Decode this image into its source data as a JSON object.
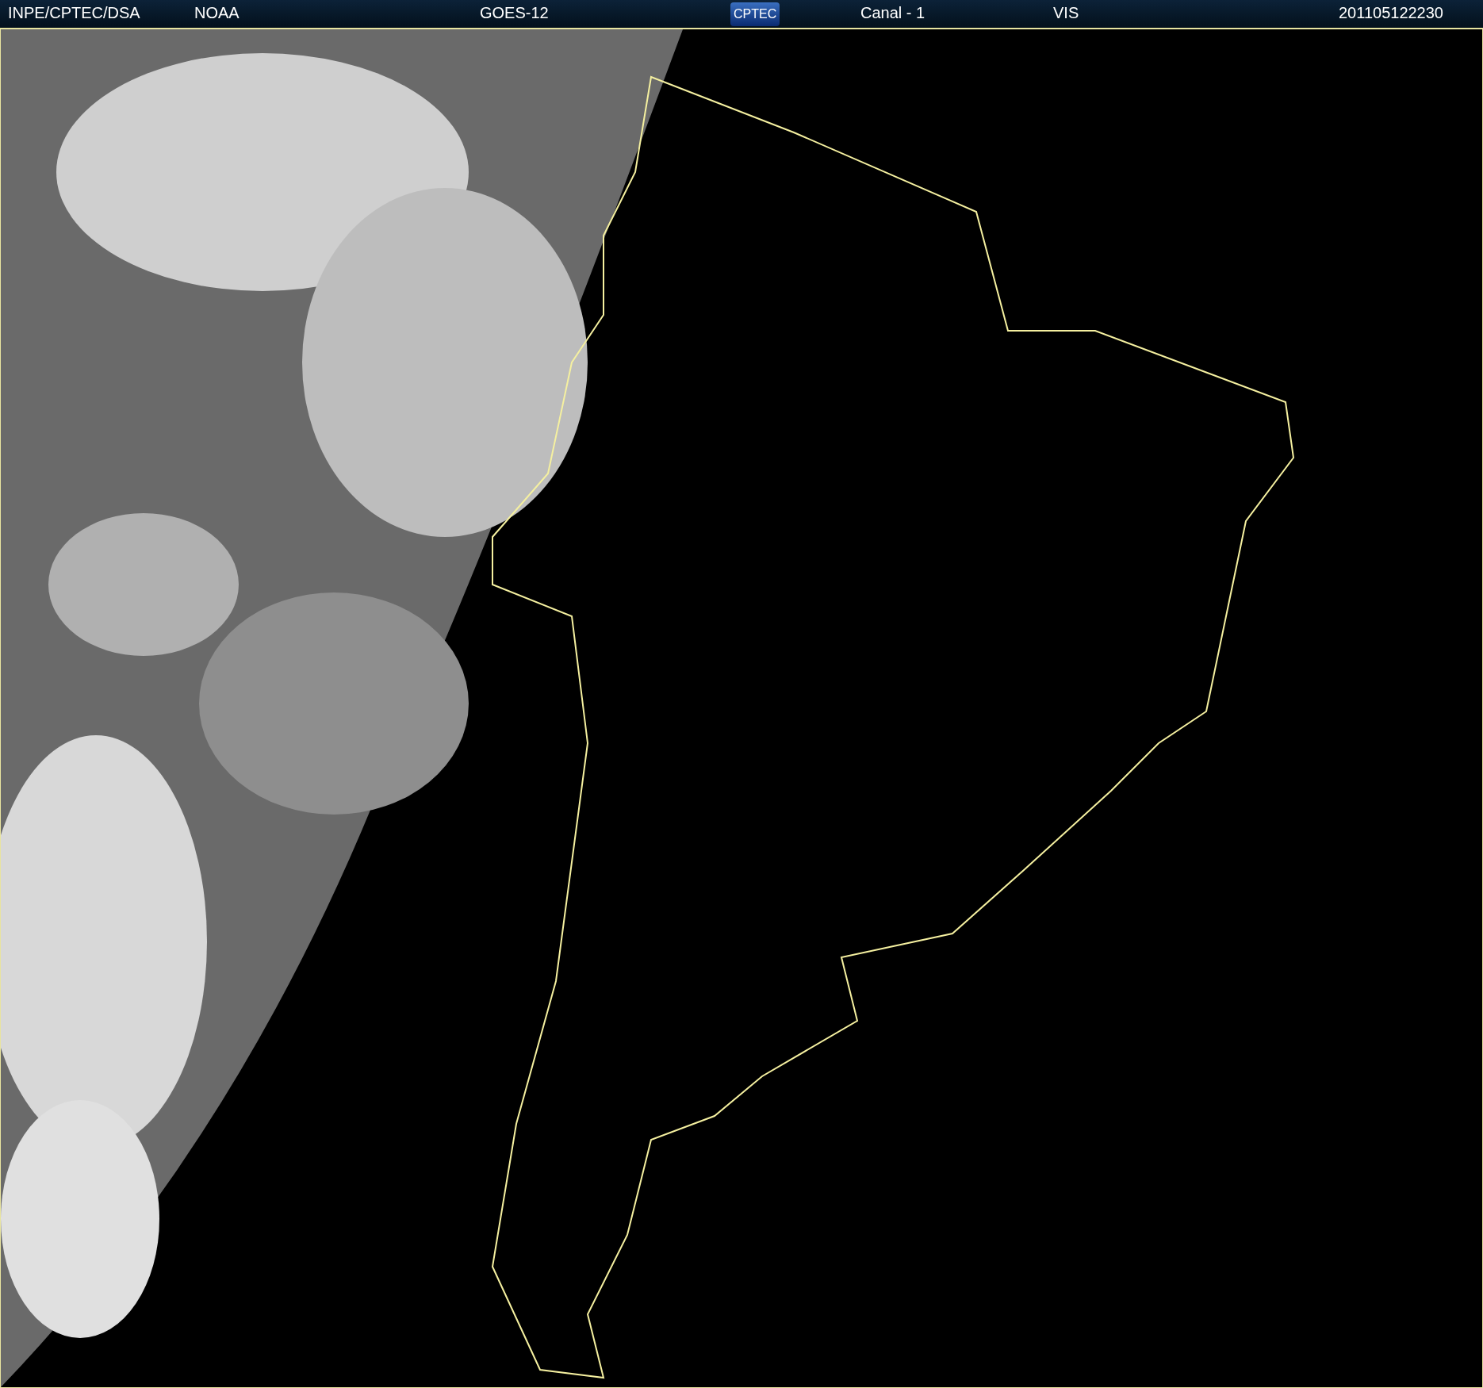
{
  "header": {
    "items": [
      {
        "kind": "text",
        "text": "INPE/CPTEC/DSA"
      },
      {
        "kind": "text",
        "text": "NOAA"
      },
      {
        "kind": "text",
        "text": "GOES-12"
      },
      {
        "kind": "logo",
        "text": "CPTEC"
      },
      {
        "kind": "text",
        "text": "Canal - 1"
      },
      {
        "kind": "text",
        "text": "VIS"
      },
      {
        "kind": "text",
        "text": "201105122230"
      }
    ]
  }
}
